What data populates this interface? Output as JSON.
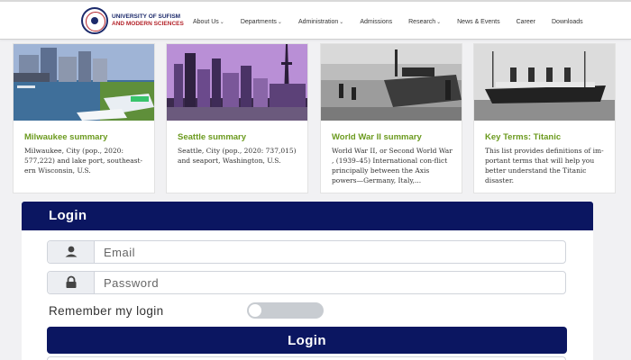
{
  "header": {
    "logo_line1": "UNIVERSITY OF SUFISM",
    "logo_line2": "AND MODERN SCIENCES",
    "nav": [
      {
        "label": "About Us",
        "has_caret": true
      },
      {
        "label": "Departments",
        "has_caret": true
      },
      {
        "label": "Administration",
        "has_caret": true
      },
      {
        "label": "Admissions",
        "has_caret": false
      },
      {
        "label": "Research",
        "has_caret": true
      },
      {
        "label": "News & Events",
        "has_caret": false
      },
      {
        "label": "Career",
        "has_caret": false
      },
      {
        "label": "Downloads",
        "has_caret": false
      }
    ]
  },
  "cards": [
    {
      "title": "Milwaukee summary",
      "desc": "Milwaukee, City (pop., 2020: 577,222) and lake port, southeast-ern Wisconsin, U.S."
    },
    {
      "title": "Seattle summary",
      "desc": "Seattle, City (pop., 2020: 737,015) and seaport, Washington, U.S."
    },
    {
      "title": "World War II summary",
      "desc": "World War II, or Second World War , (1939–45) International con-flict principally between the Axis powers—Germany, Italy,..."
    },
    {
      "title": "Key Terms: Titanic",
      "desc": "This list provides definitions of im-portant terms that will help you better understand the Titanic disaster."
    }
  ],
  "login": {
    "heading": "Login",
    "email_placeholder": "Email",
    "password_placeholder": "Password",
    "remember_label": "Remember my login",
    "remember_checked": false,
    "button_label": "Login"
  },
  "icons": {
    "email_field": "user-icon",
    "password_field": "lock-icon",
    "nav_dropdown": "chevron-down-icon"
  },
  "colors": {
    "primary": "#0b1661",
    "card_title": "#6b9a1e",
    "brand_red": "#b4232a"
  }
}
